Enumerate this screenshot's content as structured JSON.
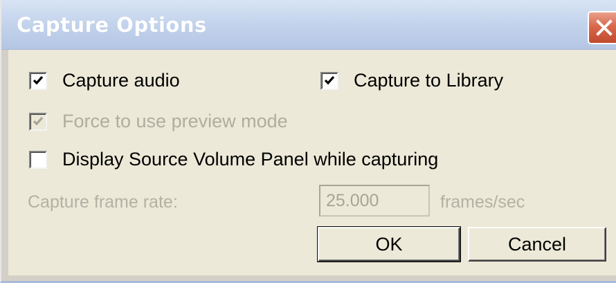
{
  "window": {
    "title": "Capture Options"
  },
  "options": {
    "capture_audio": {
      "label": "Capture audio",
      "checked": true,
      "enabled": true
    },
    "capture_to_library": {
      "label": "Capture to Library",
      "checked": true,
      "enabled": true
    },
    "force_preview_mode": {
      "label": "Force to use preview mode",
      "checked": true,
      "enabled": false
    },
    "display_source_volume": {
      "label": "Display Source Volume Panel while capturing",
      "checked": false,
      "enabled": true
    }
  },
  "frame_rate": {
    "label": "Capture frame rate:",
    "value": "25.000",
    "unit": "frames/sec",
    "enabled": false
  },
  "buttons": {
    "ok": "OK",
    "cancel": "Cancel"
  },
  "icons": {
    "close": "close-icon",
    "check": "check-icon"
  },
  "colors": {
    "titlebar": "#c3d3ec",
    "close_button": "#d9684d",
    "dialog_background": "#ece9d8",
    "disabled_text": "#b0aca0"
  }
}
